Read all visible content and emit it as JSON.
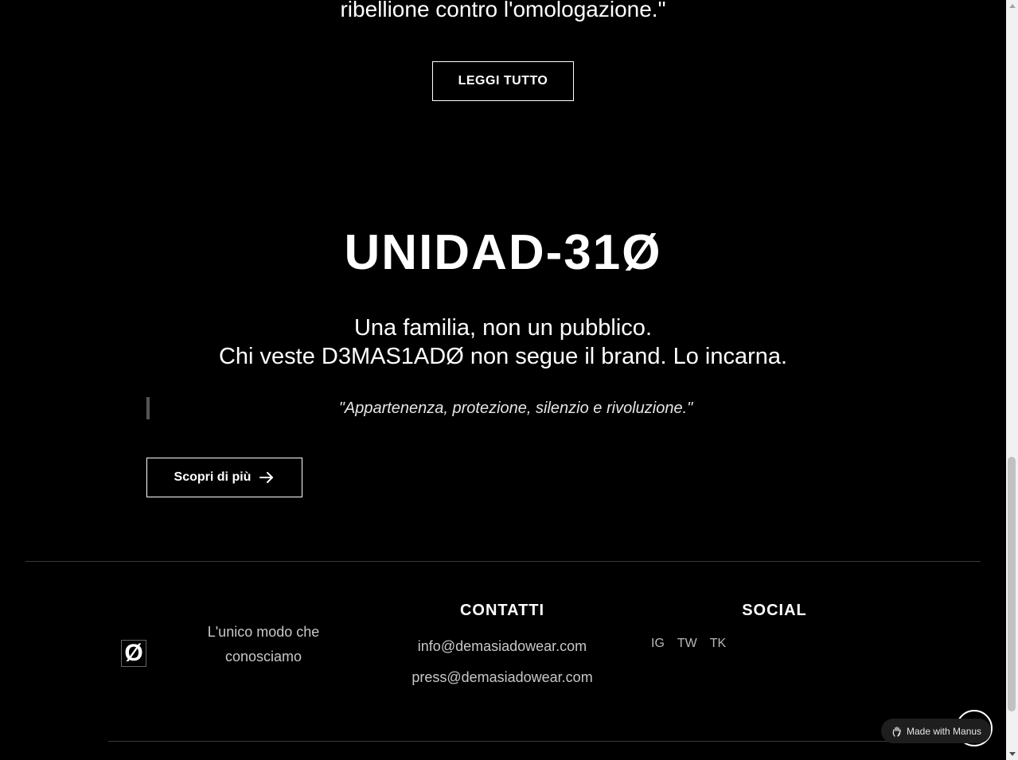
{
  "hero_quote": {
    "text_tail": "ribellione contro l'omologazione.\"",
    "read_more_label": "LEGGI TUTTO"
  },
  "unidad": {
    "title": "UNIDAD-31Ø",
    "subtitle_line1": "Una familia, non un pubblico.",
    "subtitle_line2": "Chi veste D3MAS1ADØ non segue il brand. Lo incarna.",
    "quote": "\"Appartenenza, protezione, silenzio e rivoluzione.\"",
    "discover_label": "Scopri di più"
  },
  "footer": {
    "logo_glyph": "Ø",
    "tagline": "L'unico modo che conosciamo",
    "contacts": {
      "heading": "CONTATTI",
      "email_info": "info@demasiadowear.com",
      "email_press": "press@demasiadowear.com"
    },
    "social": {
      "heading": "SOCIAL",
      "links": [
        "IG",
        "TW",
        "TK"
      ]
    }
  },
  "badge": {
    "label": "Made with Manus",
    "icon": "manus-hand-icon"
  },
  "colors": {
    "background": "#000000",
    "text": "#ffffff",
    "muted_text": "#c8c8c8",
    "divider": "#3a3a3a"
  }
}
